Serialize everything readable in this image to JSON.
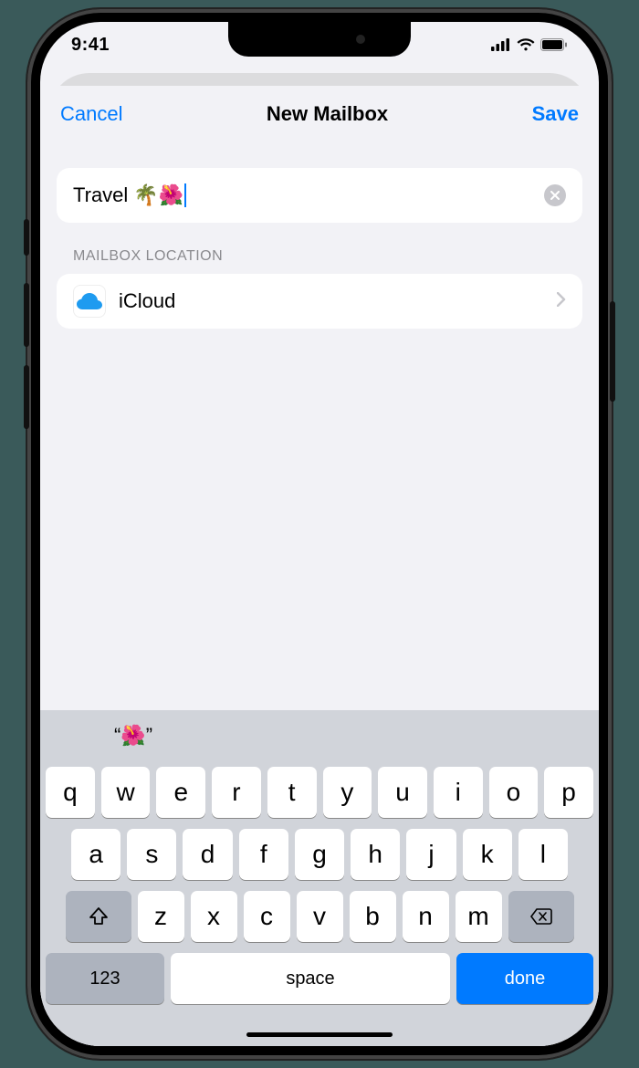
{
  "status": {
    "time": "9:41"
  },
  "nav": {
    "cancel": "Cancel",
    "title": "New Mailbox",
    "save": "Save"
  },
  "mailbox": {
    "name_value": "Travel 🌴🌺",
    "section_header": "MAILBOX LOCATION",
    "location_label": "iCloud"
  },
  "prediction": {
    "s1": "“🌺”",
    "s2": "",
    "s3": ""
  },
  "keyboard": {
    "row1": [
      "q",
      "w",
      "e",
      "r",
      "t",
      "y",
      "u",
      "i",
      "o",
      "p"
    ],
    "row2": [
      "a",
      "s",
      "d",
      "f",
      "g",
      "h",
      "j",
      "k",
      "l"
    ],
    "row3": [
      "z",
      "x",
      "c",
      "v",
      "b",
      "n",
      "m"
    ],
    "num": "123",
    "space": "space",
    "done": "done"
  }
}
